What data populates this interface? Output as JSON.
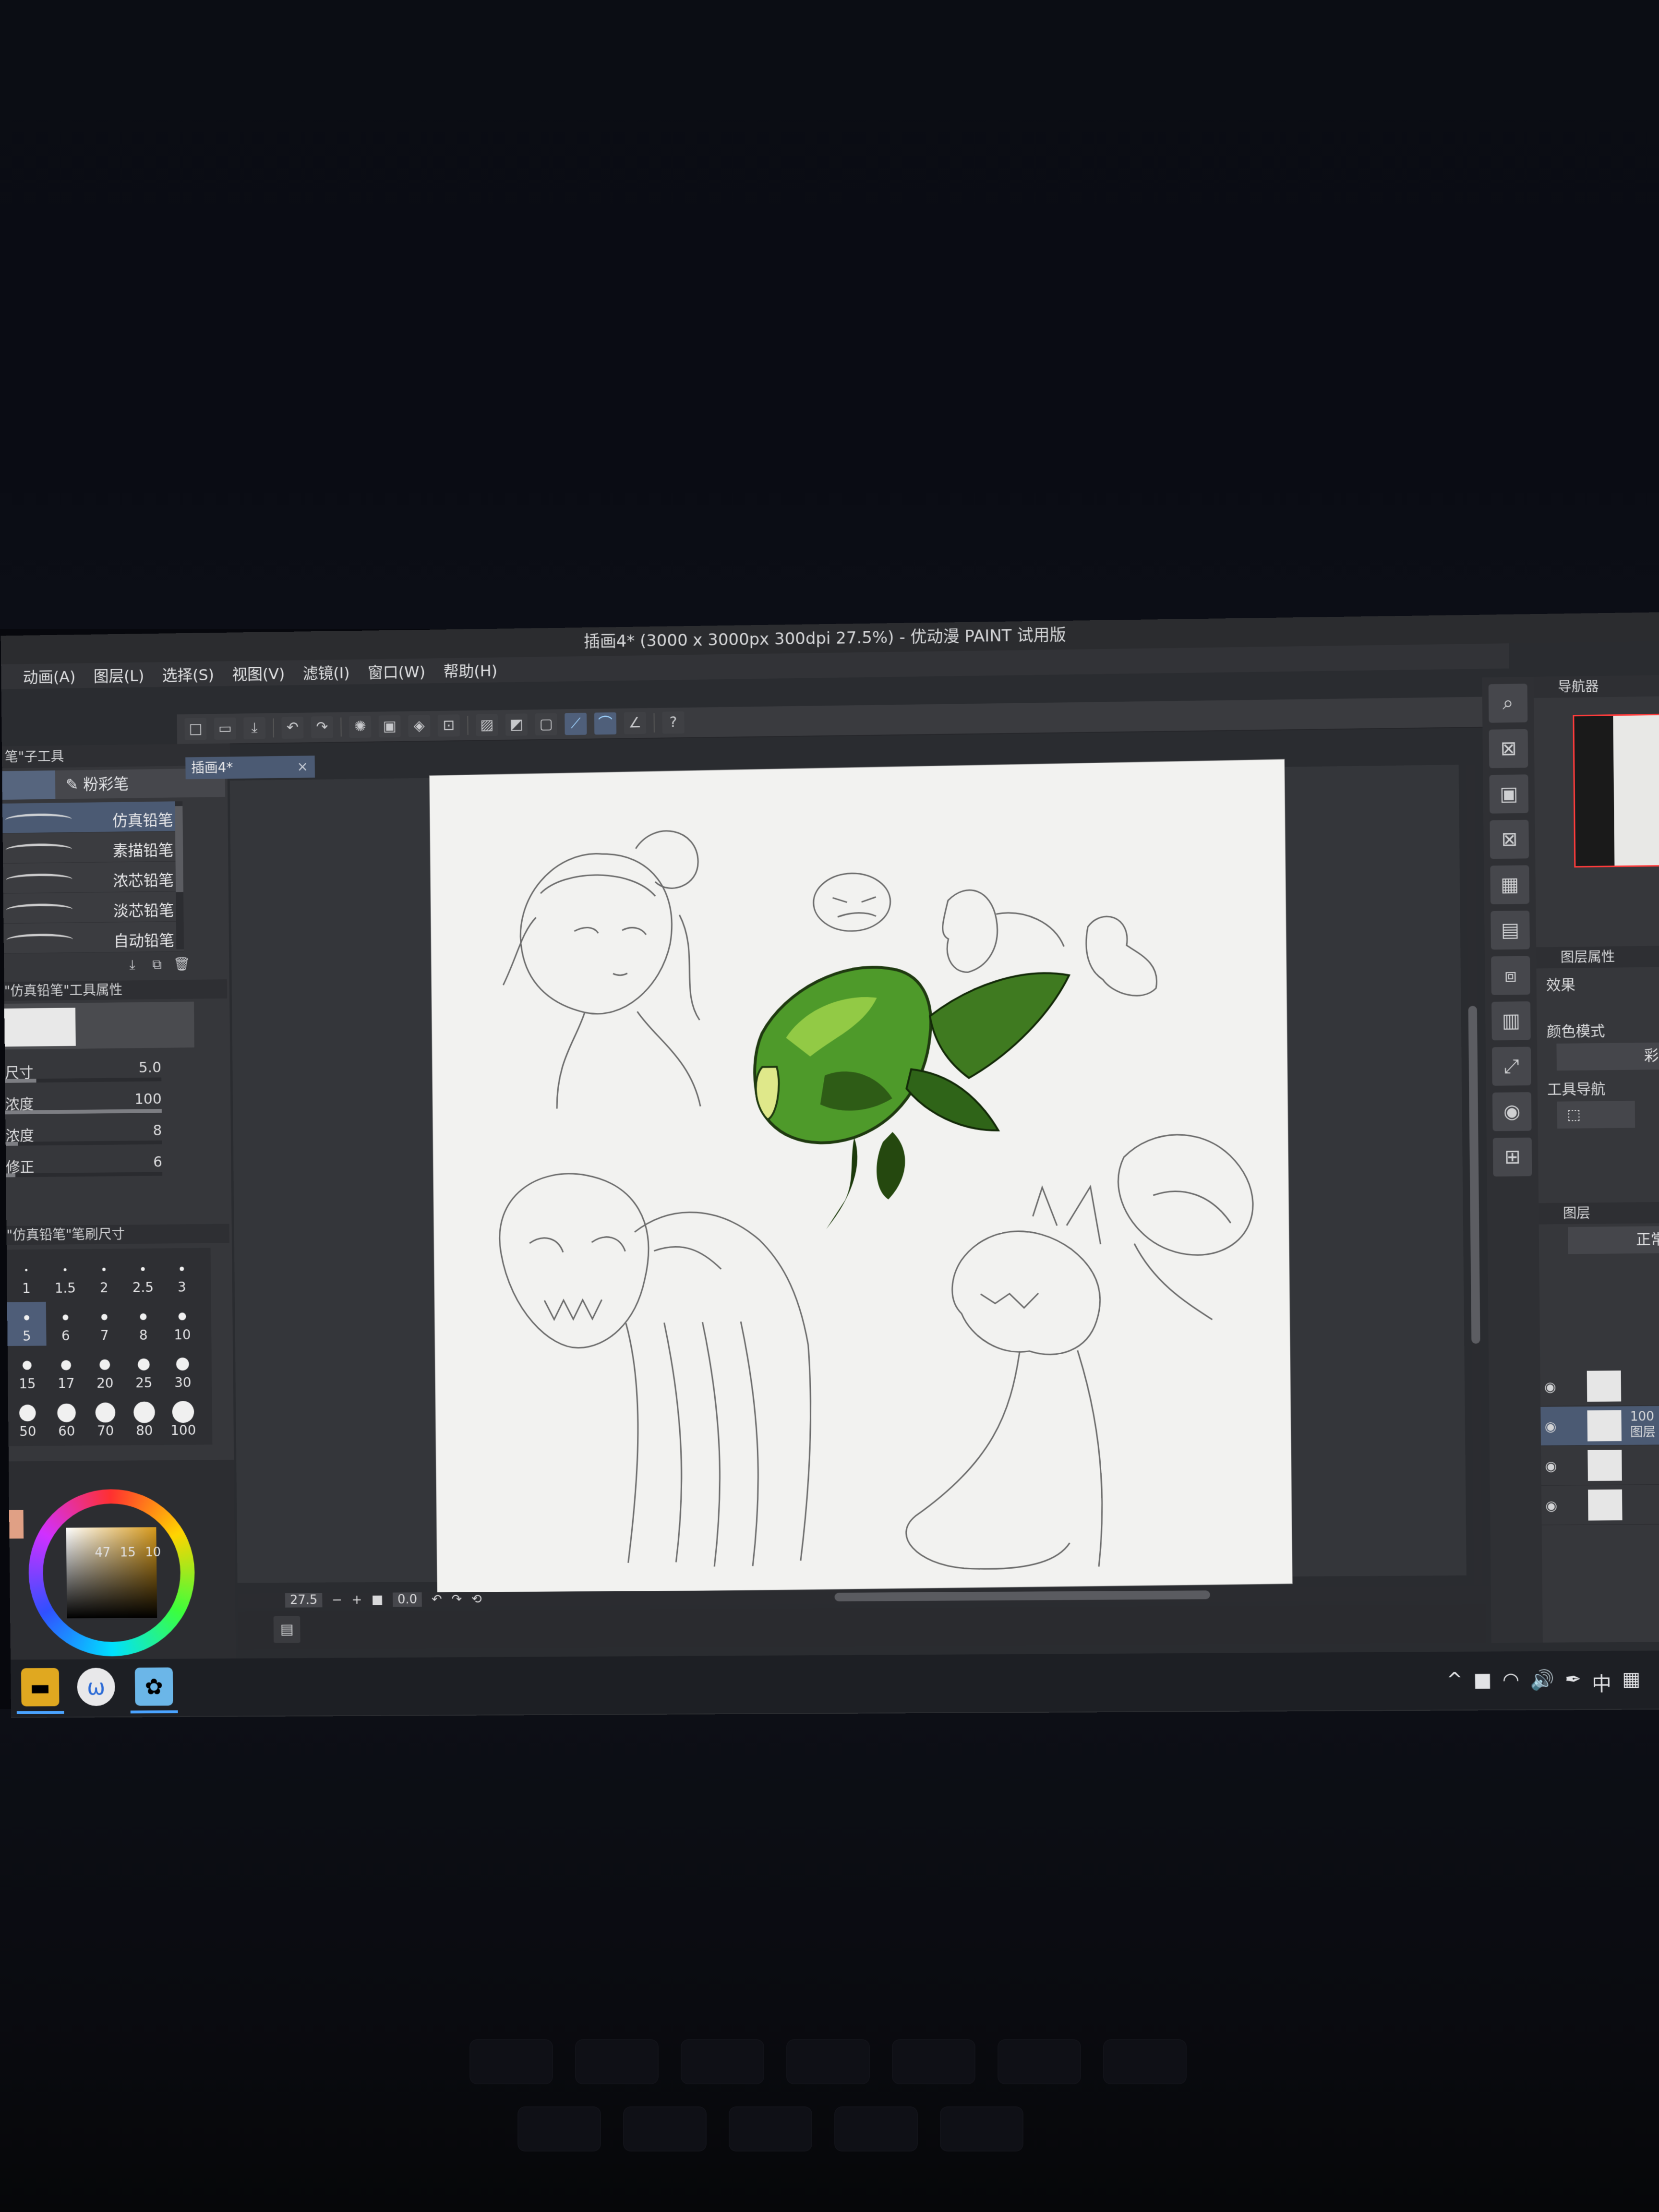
{
  "window": {
    "title": "插画4* (3000 x 3000px 300dpi 27.5%) - 优动漫 PAINT 试用版"
  },
  "menu": [
    "动画(A)",
    "图层(L)",
    "选择(S)",
    "视图(V)",
    "滤镜(I)",
    "窗口(W)",
    "帮助(H)"
  ],
  "toolbar": {
    "icons": [
      "new-canvas",
      "open",
      "save",
      "undo",
      "redo",
      "select-all",
      "deselect",
      "fill",
      "transform",
      "snap-ruler",
      "snap-grid",
      "snap-special",
      "help"
    ]
  },
  "left_panel": {
    "sub_tool_header": "笔\"子工具",
    "active_group": "粉彩笔",
    "brushes": [
      {
        "name": "仿真铅笔",
        "selected": true
      },
      {
        "name": "素描铅笔",
        "selected": false
      },
      {
        "name": "浓芯铅笔",
        "selected": false
      },
      {
        "name": "淡芯铅笔",
        "selected": false
      },
      {
        "name": "自动铅笔",
        "selected": false
      }
    ],
    "tool_property_header": "\"仿真铅笔\"工具属性",
    "properties": [
      {
        "label": "尺寸",
        "value": "5.0",
        "fill": 0.2
      },
      {
        "label": "浓度",
        "value": "100",
        "fill": 1.0
      },
      {
        "label": "浓度",
        "value": "8",
        "fill": 0.08
      },
      {
        "label": "修正",
        "value": "6",
        "fill": 0.06
      }
    ],
    "brush_size_header": "\"仿真铅笔\"笔刷尺寸",
    "sizes": [
      "1",
      "1.5",
      "2",
      "2.5",
      "3",
      "5",
      "6",
      "7",
      "8",
      "10",
      "15",
      "17",
      "20",
      "25",
      "30",
      "50",
      "60",
      "70",
      "80",
      "100"
    ],
    "selected_size": "5"
  },
  "color": {
    "h": "47",
    "s": "15",
    "v": "10",
    "main_color": "#d79a1c",
    "swatch_color": "#e0a085"
  },
  "document": {
    "tab_label": "插画4*",
    "zoom": "27.5",
    "rotation": "0.0"
  },
  "right_panel": {
    "navigator_title": "导航器",
    "layer_property_title": "图层属性",
    "effect_label": "效果",
    "color_mode_label": "颜色模式",
    "color_mode_value": "彩",
    "tool_nav_label": "工具导航",
    "layers_title": "图层",
    "blend_mode": "正常",
    "layers": [
      {
        "text": "",
        "selected": false
      },
      {
        "text": "100\n图层",
        "selected": true
      },
      {
        "text": "",
        "selected": false
      },
      {
        "text": "",
        "selected": false
      }
    ]
  },
  "taskbar": {
    "tray": [
      "^",
      "■",
      "Wi-Fi",
      "音量",
      "笔",
      "中",
      "▦"
    ]
  },
  "accent": "#4b5a73"
}
